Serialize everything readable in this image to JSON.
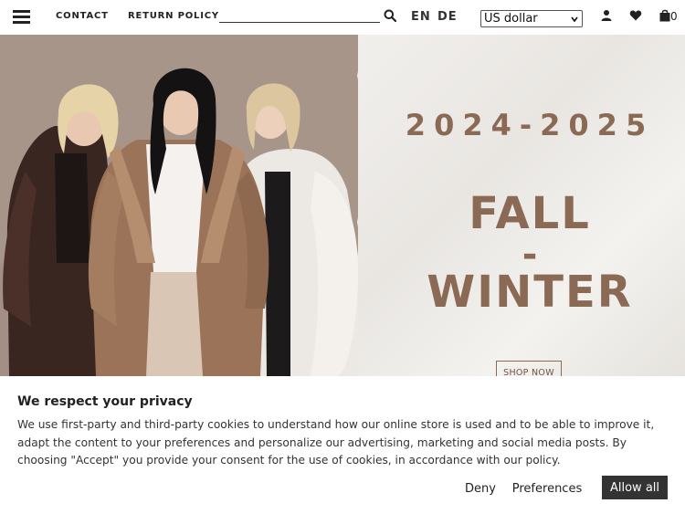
{
  "header": {
    "nav": {
      "contact": "CONTACT",
      "return_policy": "RETURN POLICY"
    },
    "search": {
      "value": "",
      "placeholder": ""
    },
    "languages": {
      "en": "EN",
      "de": "DE"
    },
    "currency": {
      "selected": "US dollar"
    },
    "cart": {
      "count": "0"
    },
    "icons": [
      "hamburger-menu-icon",
      "search-icon",
      "user-icon",
      "heart-icon",
      "shopping-bag-icon",
      "chevron-down-icon"
    ]
  },
  "hero": {
    "years": "2024-2025",
    "line1": "FALL",
    "line2": "-",
    "line3": "WINTER",
    "cta": "SHOP NOW",
    "colors": {
      "accent": "#8b6a55",
      "left_bg": "#a8958a",
      "right_bg": "#efedea"
    }
  },
  "cookie_banner": {
    "title": "We respect your privacy",
    "text": "We use first-party and third-party cookies to understand how our online store is used and to be able to improve it, adapt the content to your preferences and personalize our advertising, marketing and social media posts. By choosing \"Accept\" you provide your consent for the use of cookies, in accordance with our policy.",
    "deny": "Deny",
    "preferences": "Preferences",
    "allow_all": "Allow all",
    "colors": {
      "allow_bg": "#333333",
      "allow_text": "#ffffff"
    }
  }
}
